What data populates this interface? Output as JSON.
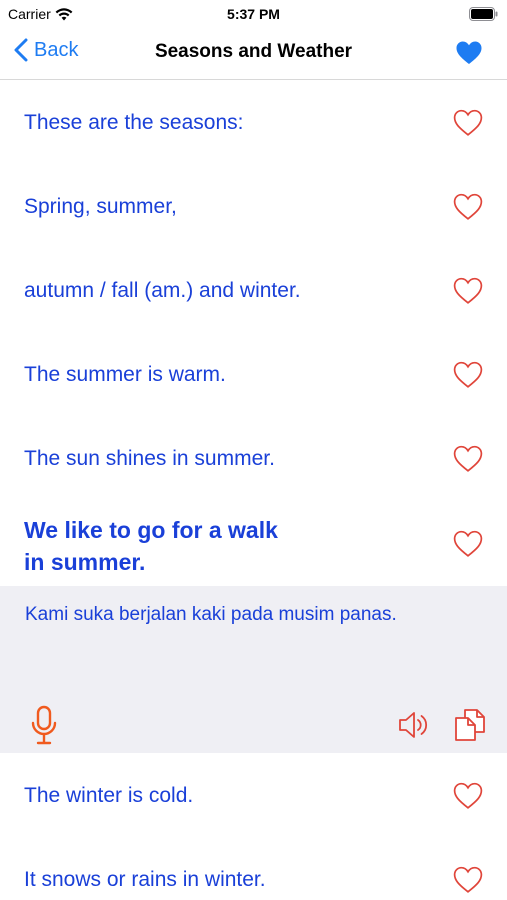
{
  "status_bar": {
    "carrier": "Carrier",
    "time": "5:37 PM"
  },
  "nav": {
    "back_label": "Back",
    "title": "Seasons and Weather",
    "favorite_icon": "heart-filled-icon"
  },
  "phrases": [
    "These are the seasons:",
    "Spring, summer,",
    "autumn / fall (am.) and winter.",
    "The summer is warm.",
    "The sun shines in summer."
  ],
  "expanded": {
    "line1": "We like to go for a walk",
    "line2": "in summer.",
    "translation": "Kami suka berjalan kaki pada musim panas."
  },
  "phrases_after": [
    "The winter is cold.",
    "It snows or rains in winter."
  ],
  "colors": {
    "accent_blue": "#1e7cf2",
    "phrase_blue": "#1a40d8",
    "heart_red": "#e0453a",
    "mic_orange": "#f05a1e",
    "panel_gray": "#efeff4"
  }
}
